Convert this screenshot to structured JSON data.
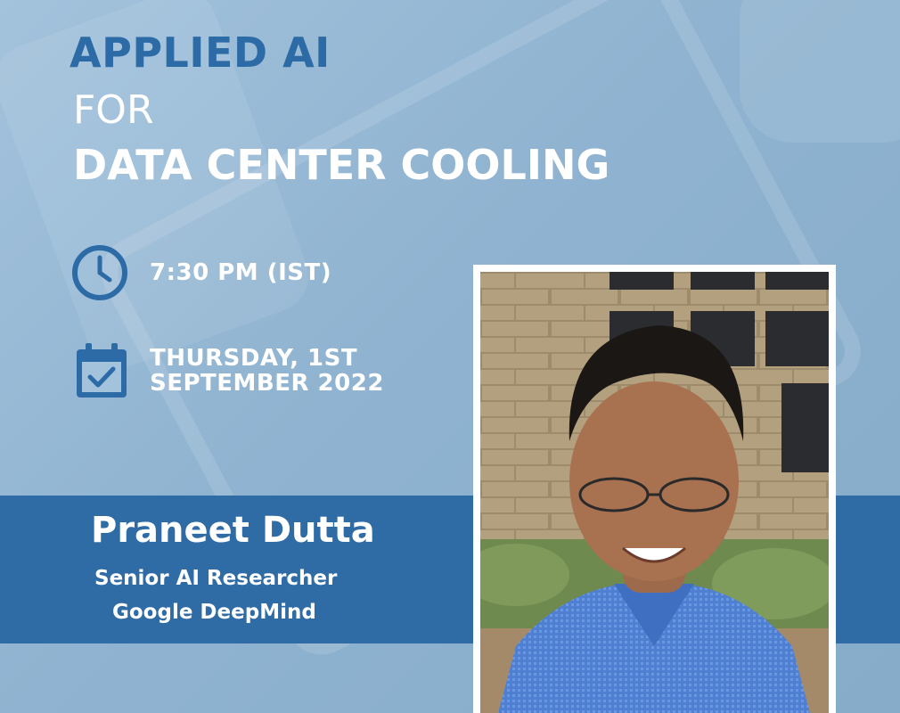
{
  "title": {
    "line1": "APPLIED AI",
    "line2": "FOR",
    "line3": "DATA CENTER COOLING"
  },
  "event": {
    "time": "7:30 PM (IST)",
    "date_line1": "THURSDAY, 1ST",
    "date_line2": "SEPTEMBER 2022"
  },
  "speaker": {
    "name": "Praneet Dutta",
    "role": "Senior AI Researcher",
    "organization": "Google DeepMind"
  },
  "icons": {
    "time": "clock-icon",
    "date": "calendar-check-icon"
  },
  "colors": {
    "accent_blue": "#2d6ba7",
    "band_blue": "#2f6ba5",
    "background": "#8fb5d2",
    "text_white": "#ffffff"
  }
}
